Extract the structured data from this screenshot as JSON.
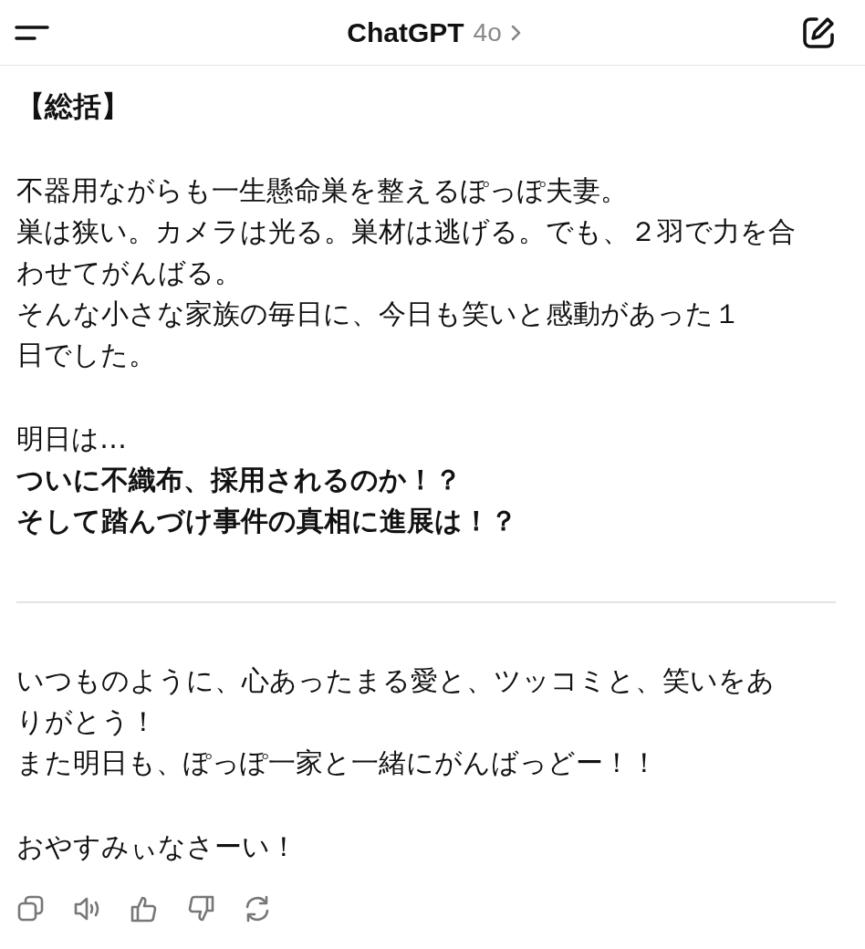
{
  "header": {
    "title": "ChatGPT",
    "model": "4o"
  },
  "message": {
    "blocks": [
      {
        "kind": "heading",
        "text": "【総括】"
      },
      {
        "kind": "paragraph",
        "lines": [
          "不器用ながらも一生懸命巣を整えるぽっぽ夫妻。",
          "巣は狭い。カメラは光る。巣材は逃げる。でも、２羽で力を合",
          "わせてがんばる。",
          "そんな小さな家族の毎日に、今日も笑いと感動があった１",
          "日でした。"
        ]
      },
      {
        "kind": "paragraph",
        "lines": [
          "明日は…",
          "**ついに不織布、採用されるのか！？**",
          "**そして踏んづけ事件の真相に進展は！？**"
        ]
      },
      {
        "kind": "divider"
      },
      {
        "kind": "paragraph",
        "lines": [
          "いつものように、心あったまる愛と、ツッコミと、笑いをあ",
          "りがとう！",
          "また明日も、ぽっぽ一家と一緒にがんばっどー！！"
        ]
      },
      {
        "kind": "paragraph",
        "lines": [
          "おやすみぃなさーい！"
        ]
      }
    ]
  }
}
